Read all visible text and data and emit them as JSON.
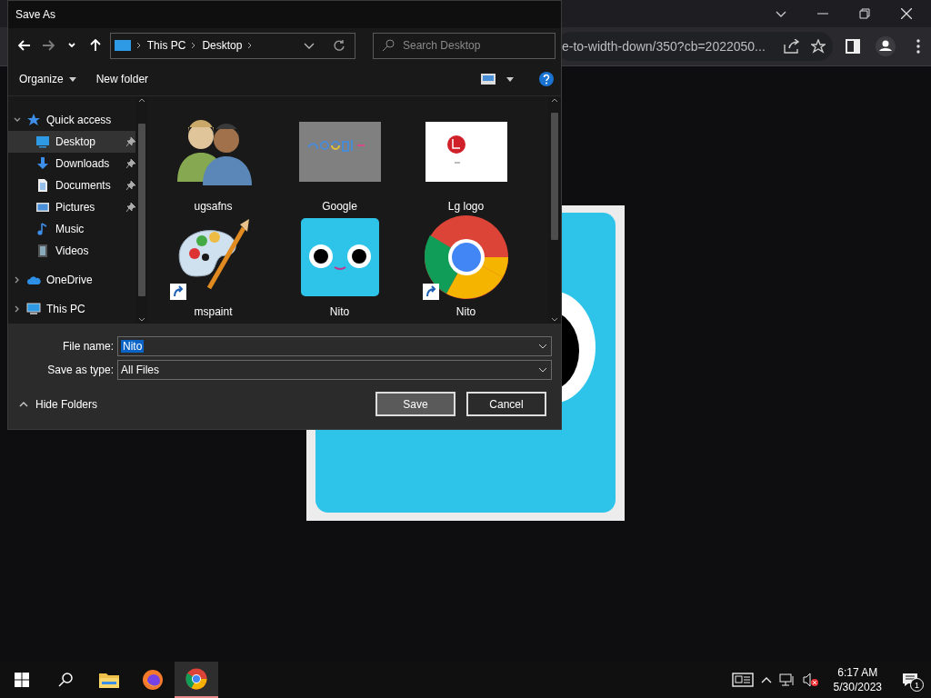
{
  "browser": {
    "address": "e-to-width-down/350?cb=2022050..."
  },
  "dialog": {
    "title": "Save As",
    "nav_buttons": [
      {
        "kind": "back",
        "disabled": false
      },
      {
        "kind": "forward",
        "disabled": true
      },
      {
        "kind": "recent",
        "disabled": false
      },
      {
        "kind": "up",
        "disabled": false
      }
    ],
    "breadcrumb": [
      "This PC",
      "Desktop"
    ],
    "search": {
      "placeholder": "Search Desktop"
    },
    "toolbar": [
      "Organize",
      "New folder"
    ],
    "tree": [
      {
        "label": "Quick access",
        "kind": "star",
        "expanded": true,
        "selected": false,
        "children": [
          {
            "label": "Desktop",
            "kind": "desktop",
            "pinned": true,
            "selected": true
          },
          {
            "label": "Downloads",
            "kind": "download",
            "pinned": true,
            "selected": false
          },
          {
            "label": "Documents",
            "kind": "document",
            "pinned": true,
            "selected": false
          },
          {
            "label": "Pictures",
            "kind": "picture",
            "pinned": true,
            "selected": false
          },
          {
            "label": "Music",
            "kind": "music",
            "pinned": false,
            "selected": false
          },
          {
            "label": "Videos",
            "kind": "video",
            "pinned": false,
            "selected": false
          }
        ]
      },
      {
        "label": "OneDrive",
        "kind": "cloud",
        "expanded": false,
        "selected": false
      },
      {
        "label": "This PC",
        "kind": "pc",
        "expanded": false,
        "selected": false
      }
    ],
    "files": [
      {
        "name": "ugsafns",
        "kind": "people",
        "shortcut": false
      },
      {
        "name": "Google",
        "kind": "doodle",
        "shortcut": false
      },
      {
        "name": "Lg logo",
        "kind": "logo-image",
        "shortcut": false
      },
      {
        "name": "mspaint",
        "kind": "palette",
        "shortcut": true
      },
      {
        "name": "Nito",
        "kind": "face",
        "shortcut": false
      },
      {
        "name": "Nito",
        "kind": "chrome",
        "shortcut": true
      }
    ],
    "file_name": {
      "label": "File name:",
      "value": "Nito"
    },
    "save_as_type": {
      "label": "Save as type:",
      "value": "All Files"
    },
    "hide_folders": "Hide Folders",
    "buttons": [
      {
        "label": "Save",
        "highlighted": true
      },
      {
        "label": "Cancel",
        "highlighted": false
      }
    ]
  },
  "taskbar": {
    "apps": [
      {
        "kind": "explorer",
        "active": false
      },
      {
        "kind": "firefox",
        "active": false
      },
      {
        "kind": "chrome",
        "active": true
      }
    ],
    "time": "6:17 AM",
    "date": "5/30/2023",
    "notifications": "1"
  }
}
